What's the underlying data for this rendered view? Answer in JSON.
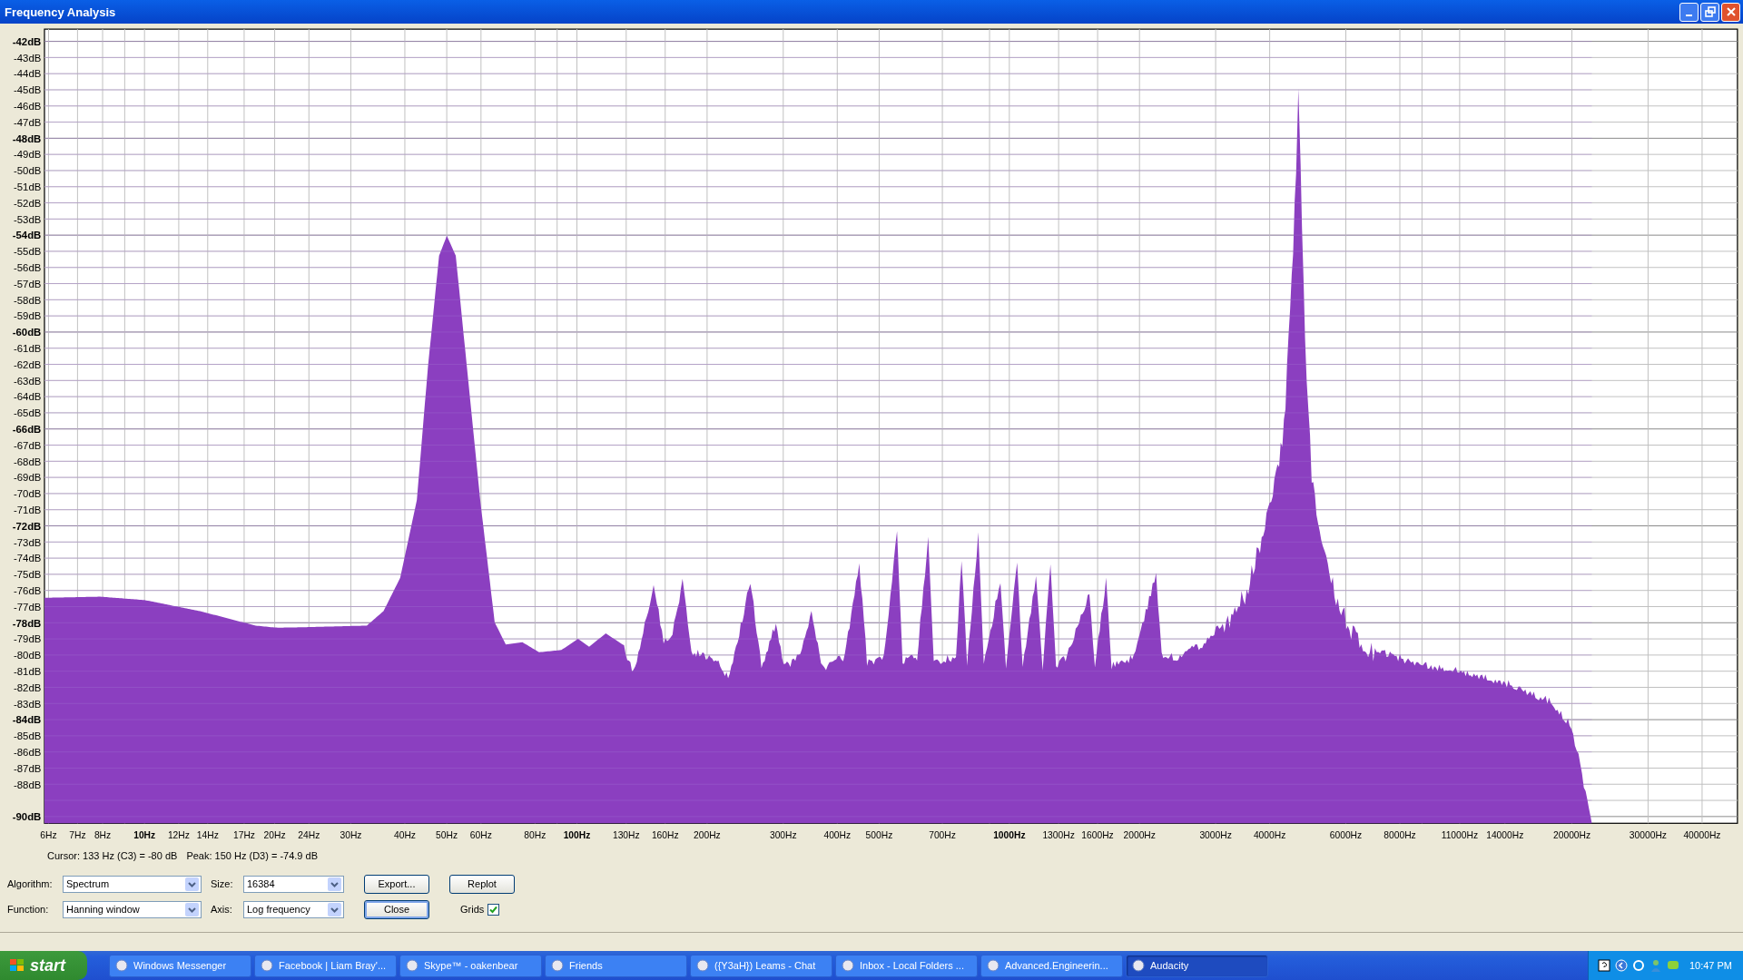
{
  "window": {
    "title": "Frequency Analysis"
  },
  "plot": {
    "y_labels": [
      {
        "text": "-42dB",
        "major": true
      },
      {
        "text": "-43dB",
        "major": false
      },
      {
        "text": "-44dB",
        "major": false
      },
      {
        "text": "-45dB",
        "major": false
      },
      {
        "text": "-46dB",
        "major": false
      },
      {
        "text": "-47dB",
        "major": false
      },
      {
        "text": "-48dB",
        "major": true
      },
      {
        "text": "-49dB",
        "major": false
      },
      {
        "text": "-50dB",
        "major": false
      },
      {
        "text": "-51dB",
        "major": false
      },
      {
        "text": "-52dB",
        "major": false
      },
      {
        "text": "-53dB",
        "major": false
      },
      {
        "text": "-54dB",
        "major": true
      },
      {
        "text": "-55dB",
        "major": false
      },
      {
        "text": "-56dB",
        "major": false
      },
      {
        "text": "-57dB",
        "major": false
      },
      {
        "text": "-58dB",
        "major": false
      },
      {
        "text": "-59dB",
        "major": false
      },
      {
        "text": "-60dB",
        "major": true
      },
      {
        "text": "-61dB",
        "major": false
      },
      {
        "text": "-62dB",
        "major": false
      },
      {
        "text": "-63dB",
        "major": false
      },
      {
        "text": "-64dB",
        "major": false
      },
      {
        "text": "-65dB",
        "major": false
      },
      {
        "text": "-66dB",
        "major": true
      },
      {
        "text": "-67dB",
        "major": false
      },
      {
        "text": "-68dB",
        "major": false
      },
      {
        "text": "-69dB",
        "major": false
      },
      {
        "text": "-70dB",
        "major": false
      },
      {
        "text": "-71dB",
        "major": false
      },
      {
        "text": "-72dB",
        "major": true
      },
      {
        "text": "-73dB",
        "major": false
      },
      {
        "text": "-74dB",
        "major": false
      },
      {
        "text": "-75dB",
        "major": false
      },
      {
        "text": "-76dB",
        "major": false
      },
      {
        "text": "-77dB",
        "major": false
      },
      {
        "text": "-78dB",
        "major": true
      },
      {
        "text": "-79dB",
        "major": false
      },
      {
        "text": "-80dB",
        "major": false
      },
      {
        "text": "-81dB",
        "major": false
      },
      {
        "text": "-82dB",
        "major": false
      },
      {
        "text": "-83dB",
        "major": false
      },
      {
        "text": "-84dB",
        "major": true
      },
      {
        "text": "-85dB",
        "major": false
      },
      {
        "text": "-86dB",
        "major": false
      },
      {
        "text": "-87dB",
        "major": false
      },
      {
        "text": "-88dB",
        "major": false
      },
      {
        "text": "-90dB",
        "major": true
      }
    ],
    "x_labels": [
      {
        "text": "6Hz",
        "major": false
      },
      {
        "text": "7Hz",
        "major": false
      },
      {
        "text": "8Hz",
        "major": false
      },
      {
        "text": "10Hz",
        "major": true
      },
      {
        "text": "12Hz",
        "major": false
      },
      {
        "text": "14Hz",
        "major": false
      },
      {
        "text": "17Hz",
        "major": false
      },
      {
        "text": "20Hz",
        "major": false
      },
      {
        "text": "24Hz",
        "major": false
      },
      {
        "text": "30Hz",
        "major": false
      },
      {
        "text": "40Hz",
        "major": false
      },
      {
        "text": "50Hz",
        "major": false
      },
      {
        "text": "60Hz",
        "major": false
      },
      {
        "text": "80Hz",
        "major": false
      },
      {
        "text": "100Hz",
        "major": true
      },
      {
        "text": "130Hz",
        "major": false
      },
      {
        "text": "160Hz",
        "major": false
      },
      {
        "text": "200Hz",
        "major": false
      },
      {
        "text": "300Hz",
        "major": false
      },
      {
        "text": "400Hz",
        "major": false
      },
      {
        "text": "500Hz",
        "major": false
      },
      {
        "text": "700Hz",
        "major": false
      },
      {
        "text": "1000Hz",
        "major": true
      },
      {
        "text": "1300Hz",
        "major": false
      },
      {
        "text": "1600Hz",
        "major": false
      },
      {
        "text": "2000Hz",
        "major": false
      },
      {
        "text": "3000Hz",
        "major": false
      },
      {
        "text": "4000Hz",
        "major": false
      },
      {
        "text": "6000Hz",
        "major": false
      },
      {
        "text": "8000Hz",
        "major": false
      },
      {
        "text": "11000Hz",
        "major": false
      },
      {
        "text": "14000Hz",
        "major": false
      },
      {
        "text": "20000Hz",
        "major": false
      },
      {
        "text": "30000Hz",
        "major": false
      },
      {
        "text": "40000Hz",
        "major": false
      }
    ]
  },
  "readout": {
    "cursor": "Cursor: 133 Hz (C3) = -80 dB",
    "peak": "Peak: 150 Hz (D3) = -74.9 dB"
  },
  "controls": {
    "algorithm": {
      "label": "Algorithm:",
      "value": "Spectrum"
    },
    "function": {
      "label": "Function:",
      "value": "Hanning window"
    },
    "size": {
      "label": "Size:",
      "value": "16384"
    },
    "axis": {
      "label": "Axis:",
      "value": "Log frequency"
    },
    "buttons": [
      {
        "label": "Export...",
        "focused": false
      },
      {
        "label": "Replot",
        "focused": false
      },
      {
        "label": "Close",
        "focused": true
      }
    ],
    "grids": {
      "label": "Grids",
      "checked": true
    }
  },
  "taskbar": {
    "start": "start",
    "tasks": [
      {
        "label": "Windows Messenger",
        "selected": false
      },
      {
        "label": "Facebook | Liam Bray'...",
        "selected": false
      },
      {
        "label": "Skype™ - oakenbear",
        "selected": false
      },
      {
        "label": "Friends",
        "selected": false
      },
      {
        "label": "({Y3aH}) Leams - Chat",
        "selected": false
      },
      {
        "label": "Inbox - Local Folders ...",
        "selected": false
      },
      {
        "label": "Advanced.Engineerin...",
        "selected": false
      },
      {
        "label": "Audacity",
        "selected": true
      }
    ],
    "clock": "10:47 PM"
  }
}
